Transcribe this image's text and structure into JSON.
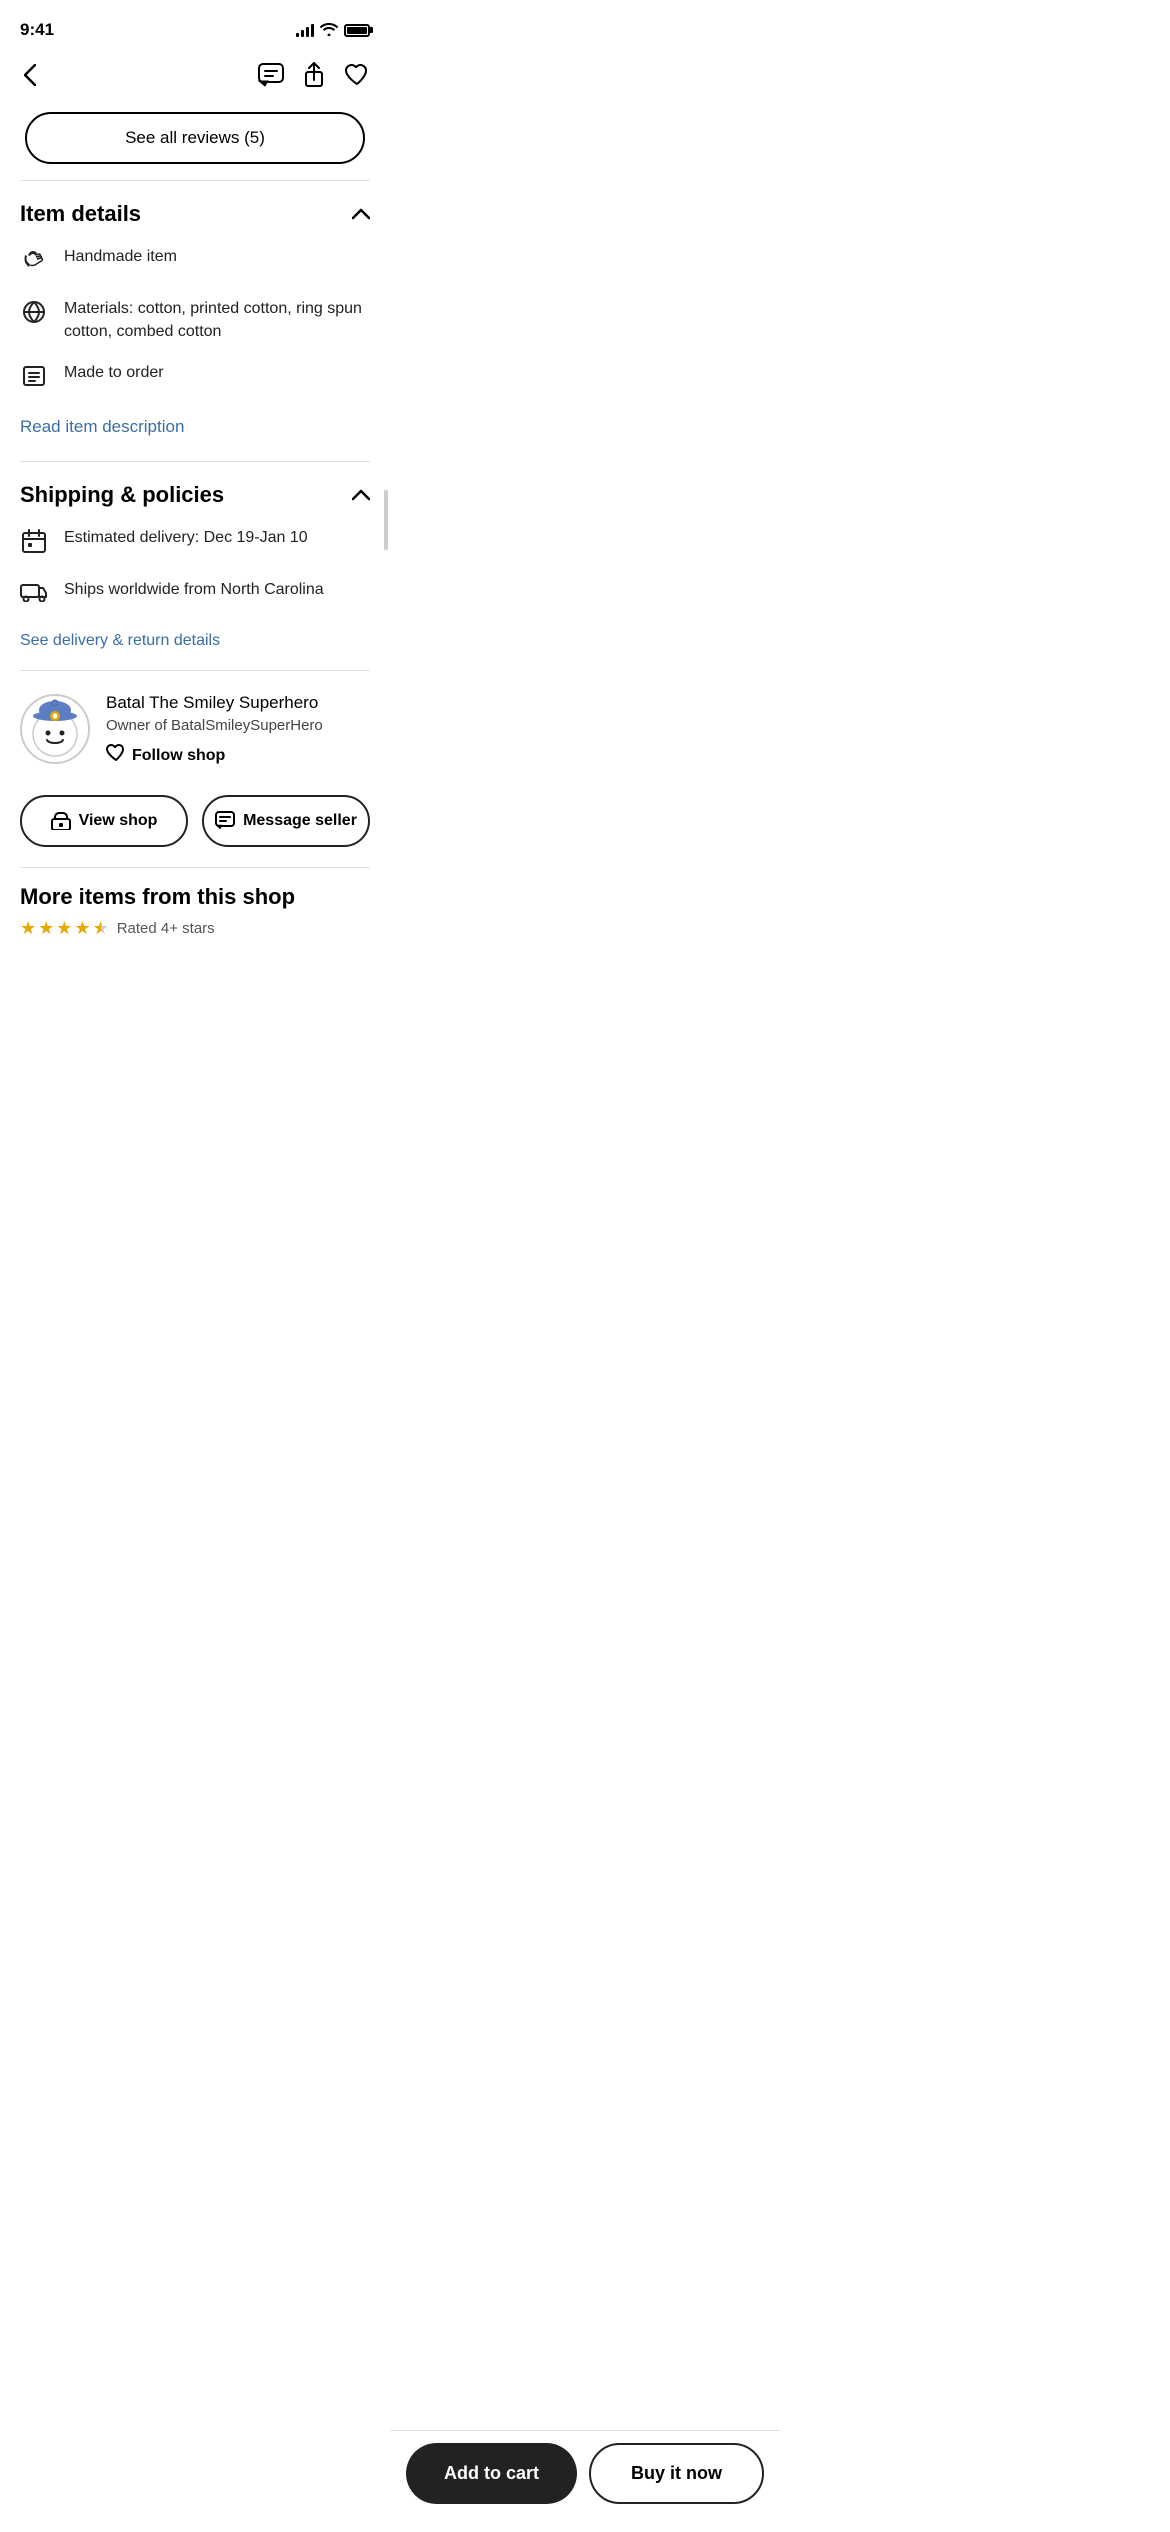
{
  "statusBar": {
    "time": "9:41"
  },
  "nav": {
    "backLabel": "‹",
    "icons": {
      "chat": "💬",
      "share": "⬆",
      "heart": "♡"
    }
  },
  "reviewsButton": {
    "label": "See all reviews (5)"
  },
  "itemDetails": {
    "sectionTitle": "Item details",
    "items": [
      {
        "icon": "handmade",
        "text": "Handmade item"
      },
      {
        "icon": "materials",
        "text": "Materials: cotton, printed cotton, ring spun cotton, combed cotton"
      },
      {
        "icon": "order",
        "text": "Made to order"
      }
    ],
    "readMoreLink": "Read item description"
  },
  "shippingPolicies": {
    "sectionTitle": "Shipping & policies",
    "items": [
      {
        "icon": "calendar",
        "text": "Estimated delivery: Dec 19-Jan 10"
      },
      {
        "icon": "truck",
        "text": "Ships worldwide from North Carolina"
      }
    ],
    "deliveryLink": "See delivery & return details"
  },
  "shop": {
    "name": "Batal The Smiley Superhero",
    "owner": "Owner of BatalSmileySuperHero",
    "followLabel": "Follow shop",
    "viewShopLabel": "View shop",
    "messageSellerLabel": "Message seller"
  },
  "moreItems": {
    "title": "More items from this shop",
    "ratingText": "Rated 4+ stars"
  },
  "bottomBar": {
    "addToCartLabel": "Add to cart",
    "buyNowLabel": "Buy it now"
  }
}
